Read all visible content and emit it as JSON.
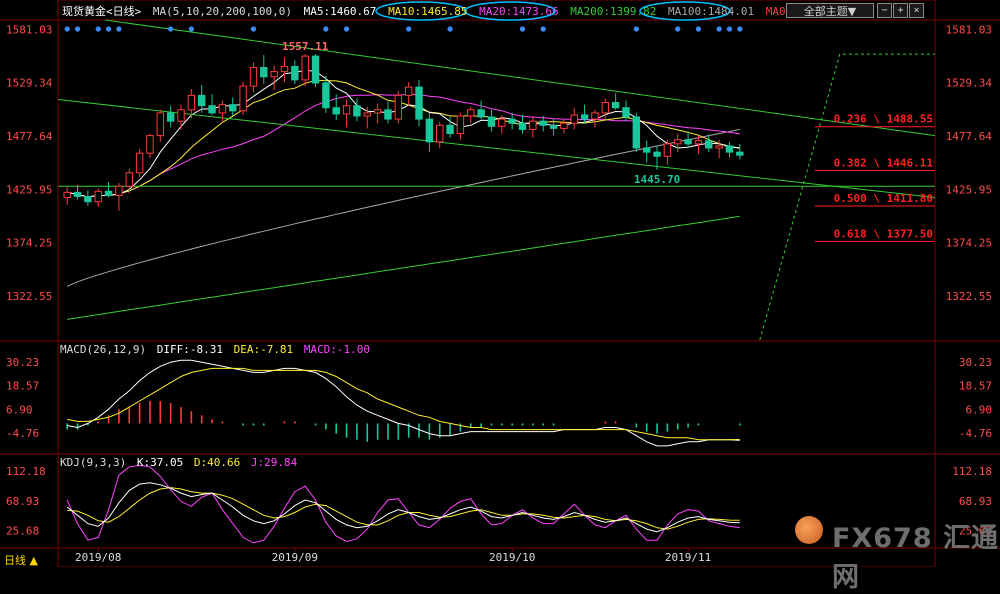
{
  "header": {
    "title": "现货黄金<日线>",
    "ma_main": "MA(5,10,20,200,100,0)",
    "ma5": "MA5:1460.67",
    "ma10": "MA10:1465.85",
    "ma20": "MA20:1473.66",
    "ma200": "MA200:1399.82",
    "ma100": "MA100:1484.01",
    "ma0": "MA0",
    "selector": "全部主题▼",
    "ctrl_dec": "−",
    "ctrl_inc": "+",
    "ctrl_close": "×"
  },
  "macd_header": {
    "label": "MACD(26,12,9)",
    "diff": "DIFF:-8.31",
    "dea": "DEA:-7.81",
    "macd": "MACD:-1.00"
  },
  "kdj_header": {
    "label": "KDJ(9,3,3)",
    "k": "K:37.05",
    "d": "D:40.66",
    "j": "J:29.84"
  },
  "footer": {
    "period_tab": "日线 ▲"
  },
  "watermark": {
    "text": "FX678 汇通网"
  },
  "colors": {
    "bg": "#000000",
    "up": "#ff3b3b",
    "down": "#19c79c",
    "grid": "#3a0000",
    "axis_text": "#ff4b4b",
    "ma5": "#ffffff",
    "ma10": "#ffee33",
    "ma20": "#ff44ff",
    "ma200": "#33cc33",
    "ma100": "#aaaaaa",
    "channel": "#33cc33",
    "fib": "#ff2020",
    "highlight": "#00bfff"
  },
  "chart_data": [
    {
      "type": "candlestick",
      "title": "现货黄金<日线>",
      "x": [
        "2019/08",
        "2019/09",
        "2019/10",
        "2019/11"
      ],
      "ylim": [
        1280,
        1590
      ],
      "y_ticks": [
        1581.03,
        1529.34,
        1477.64,
        1425.95,
        1374.25,
        1322.55
      ],
      "annotations": [
        {
          "label": "1557.11",
          "value": 1557.11
        },
        {
          "label": "1445.70",
          "value": 1445.7
        }
      ],
      "fibonacci": [
        {
          "label": "0.236 \\ 1488.55",
          "value": 1488.55
        },
        {
          "label": "0.382 \\ 1446.11",
          "value": 1446.11
        },
        {
          "label": "0.500 \\ 1411.80",
          "value": 1411.8
        },
        {
          "label": "0.618 \\ 1377.50",
          "value": 1377.5
        }
      ],
      "candles": [
        [
          1418,
          1428,
          1411,
          1423
        ],
        [
          1423,
          1430,
          1416,
          1419
        ],
        [
          1419,
          1425,
          1410,
          1414
        ],
        [
          1414,
          1427,
          1409,
          1424
        ],
        [
          1424,
          1433,
          1418,
          1420
        ],
        [
          1420,
          1432,
          1405,
          1429
        ],
        [
          1429,
          1446,
          1422,
          1442
        ],
        [
          1442,
          1465,
          1438,
          1461
        ],
        [
          1461,
          1480,
          1456,
          1478
        ],
        [
          1478,
          1503,
          1472,
          1500
        ],
        [
          1500,
          1507,
          1486,
          1492
        ],
        [
          1492,
          1508,
          1484,
          1503
        ],
        [
          1503,
          1523,
          1495,
          1517
        ],
        [
          1517,
          1527,
          1500,
          1507
        ],
        [
          1507,
          1518,
          1498,
          1500
        ],
        [
          1500,
          1512,
          1490,
          1508
        ],
        [
          1508,
          1515,
          1497,
          1502
        ],
        [
          1502,
          1530,
          1498,
          1526
        ],
        [
          1526,
          1549,
          1520,
          1544
        ],
        [
          1544,
          1556,
          1528,
          1535
        ],
        [
          1535,
          1546,
          1522,
          1540
        ],
        [
          1540,
          1554,
          1530,
          1545
        ],
        [
          1545,
          1551,
          1528,
          1532
        ],
        [
          1532,
          1557,
          1526,
          1555
        ],
        [
          1555,
          1557,
          1525,
          1529
        ],
        [
          1529,
          1536,
          1500,
          1505
        ],
        [
          1505,
          1518,
          1493,
          1499
        ],
        [
          1499,
          1513,
          1486,
          1507
        ],
        [
          1507,
          1514,
          1492,
          1497
        ],
        [
          1497,
          1506,
          1485,
          1500
        ],
        [
          1500,
          1509,
          1490,
          1503
        ],
        [
          1503,
          1511,
          1490,
          1494
        ],
        [
          1494,
          1521,
          1490,
          1517
        ],
        [
          1517,
          1530,
          1507,
          1525
        ],
        [
          1525,
          1532,
          1487,
          1494
        ],
        [
          1494,
          1500,
          1462,
          1472
        ],
        [
          1472,
          1491,
          1466,
          1488
        ],
        [
          1488,
          1496,
          1476,
          1480
        ],
        [
          1480,
          1500,
          1474,
          1497
        ],
        [
          1497,
          1506,
          1490,
          1503
        ],
        [
          1503,
          1512,
          1494,
          1496
        ],
        [
          1496,
          1503,
          1482,
          1487
        ],
        [
          1487,
          1498,
          1480,
          1494
        ],
        [
          1494,
          1500,
          1484,
          1490
        ],
        [
          1490,
          1498,
          1480,
          1484
        ],
        [
          1484,
          1497,
          1476,
          1492
        ],
        [
          1492,
          1497,
          1482,
          1488
        ],
        [
          1488,
          1494,
          1478,
          1485
        ],
        [
          1485,
          1494,
          1480,
          1490
        ],
        [
          1490,
          1505,
          1484,
          1498
        ],
        [
          1498,
          1508,
          1490,
          1494
        ],
        [
          1494,
          1503,
          1486,
          1500
        ],
        [
          1500,
          1514,
          1494,
          1510
        ],
        [
          1510,
          1519,
          1503,
          1505
        ],
        [
          1505,
          1512,
          1492,
          1496
        ],
        [
          1496,
          1500,
          1462,
          1466
        ],
        [
          1466,
          1473,
          1452,
          1462
        ],
        [
          1462,
          1468,
          1445,
          1458
        ],
        [
          1458,
          1474,
          1450,
          1470
        ],
        [
          1470,
          1480,
          1462,
          1474
        ],
        [
          1474,
          1482,
          1466,
          1470
        ],
        [
          1470,
          1478,
          1460,
          1473
        ],
        [
          1473,
          1479,
          1462,
          1466
        ],
        [
          1466,
          1474,
          1456,
          1468
        ],
        [
          1468,
          1472,
          1457,
          1462
        ],
        [
          1462,
          1470,
          1455,
          1459
        ]
      ],
      "moving_averages": {
        "MA200_end": 1399.82,
        "MA100_end": 1484.01,
        "MA20_end": 1473.66,
        "MA10_end": 1465.85,
        "MA5_end": 1460.67
      }
    },
    {
      "type": "macd",
      "title": "MACD(26,12,9)",
      "y_ticks": [
        30.23,
        18.57,
        6.9,
        -4.76
      ],
      "ylim": [
        -14,
        36
      ],
      "diff": [
        -1,
        -2,
        0,
        3,
        7,
        12,
        16,
        21,
        25,
        28,
        30,
        31,
        31,
        30,
        29,
        28,
        27,
        26,
        25,
        25,
        26,
        27,
        27,
        26,
        25,
        22,
        18,
        13,
        9,
        6,
        4,
        2,
        0,
        -1,
        -3,
        -5,
        -6,
        -6,
        -5,
        -4,
        -4,
        -4,
        -4,
        -4,
        -4,
        -4,
        -4,
        -4,
        -3,
        -3,
        -3,
        -3,
        -2,
        -2,
        -3,
        -6,
        -9,
        -11,
        -11,
        -10,
        -9,
        -9,
        -8,
        -8,
        -8,
        -8.31
      ],
      "dea": [
        2,
        1,
        1,
        2,
        3,
        5,
        8,
        11,
        14,
        17,
        20,
        23,
        25,
        26,
        27,
        27,
        27,
        27,
        26,
        26,
        26,
        26,
        26,
        26,
        26,
        25,
        23,
        20,
        17,
        15,
        12,
        10,
        8,
        6,
        4,
        3,
        1,
        0,
        -1,
        -2,
        -2,
        -3,
        -3,
        -3,
        -3,
        -3,
        -3,
        -3,
        -3,
        -3,
        -3,
        -3,
        -3,
        -3,
        -3,
        -4,
        -5,
        -6,
        -7,
        -7,
        -7,
        -8,
        -8,
        -8,
        -8,
        -7.81
      ],
      "histogram": [
        -3,
        -3,
        -1,
        1,
        4,
        7,
        8,
        10,
        11,
        11,
        10,
        8,
        6,
        4,
        2,
        1,
        0,
        -1,
        -1,
        -1,
        0,
        1,
        1,
        0,
        -1,
        -3,
        -5,
        -7,
        -8,
        -9,
        -8,
        -8,
        -8,
        -7,
        -7,
        -8,
        -7,
        -6,
        -4,
        -2,
        -2,
        -1,
        -1,
        -1,
        -1,
        -1,
        -1,
        -1,
        0,
        0,
        0,
        0,
        1,
        1,
        0,
        -2,
        -4,
        -5,
        -4,
        -3,
        -2,
        -1,
        0,
        0,
        0,
        -1
      ]
    },
    {
      "type": "kdj",
      "title": "KDJ(9,3,3)",
      "y_ticks": [
        112.18,
        68.93,
        25.68
      ],
      "ylim": [
        5,
        125
      ],
      "k": [
        60,
        48,
        36,
        32,
        44,
        66,
        84,
        93,
        95,
        92,
        87,
        80,
        75,
        78,
        80,
        70,
        60,
        48,
        40,
        36,
        40,
        50,
        62,
        70,
        66,
        54,
        42,
        34,
        30,
        32,
        40,
        50,
        56,
        52,
        46,
        42,
        44,
        50,
        56,
        60,
        54,
        46,
        44,
        48,
        52,
        48,
        44,
        42,
        46,
        52,
        48,
        42,
        38,
        40,
        44,
        36,
        28,
        24,
        30,
        38,
        44,
        46,
        42,
        40,
        38,
        37.05
      ],
      "d": [
        55,
        54,
        48,
        40,
        38,
        46,
        58,
        70,
        80,
        86,
        88,
        86,
        82,
        80,
        80,
        77,
        72,
        64,
        56,
        48,
        44,
        46,
        52,
        60,
        64,
        62,
        54,
        46,
        38,
        34,
        34,
        40,
        48,
        52,
        52,
        48,
        45,
        46,
        50,
        54,
        56,
        52,
        48,
        48,
        50,
        50,
        48,
        45,
        44,
        46,
        48,
        46,
        42,
        40,
        42,
        40,
        36,
        30,
        28,
        32,
        38,
        42,
        43,
        42,
        41,
        40.66
      ],
      "j": [
        70,
        36,
        12,
        16,
        56,
        106,
        118,
        120,
        118,
        104,
        85,
        68,
        61,
        74,
        80,
        56,
        36,
        16,
        8,
        12,
        32,
        58,
        82,
        90,
        70,
        38,
        18,
        10,
        14,
        28,
        52,
        70,
        72,
        52,
        34,
        30,
        42,
        58,
        68,
        72,
        50,
        34,
        36,
        48,
        56,
        44,
        36,
        36,
        50,
        64,
        48,
        34,
        30,
        40,
        48,
        28,
        12,
        12,
        34,
        50,
        56,
        54,
        40,
        36,
        32,
        29.84
      ]
    }
  ]
}
